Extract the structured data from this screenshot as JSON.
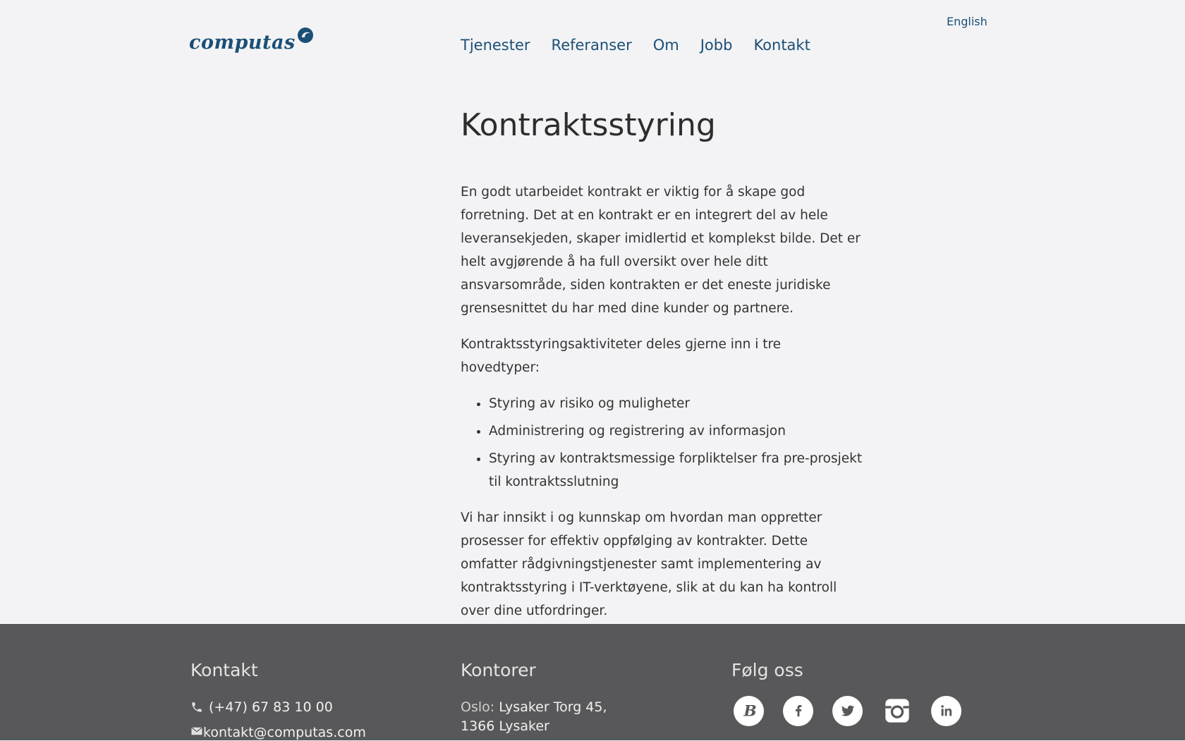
{
  "header": {
    "logo_text": "computas",
    "language_link": "English",
    "nav": [
      "Tjenester",
      "Referanser",
      "Om",
      "Jobb",
      "Kontakt"
    ]
  },
  "article": {
    "title": "Kontraktsstyring",
    "intro": "En godt utarbeidet kontrakt er viktig for å skape god forretning. Det at en kontrakt er en integrert del av hele leveransekjeden, skaper imidlertid et komplekst bilde. Det er helt avgjørende å ha full oversikt over hele ditt ansvarsområde, siden kontrakten er det eneste juridiske grensesnittet du har med dine kunder og partnere.",
    "list_intro": "Kontraktsstyringsaktiviteter deles gjerne inn i tre hovedtyper:",
    "list": [
      "Styring av risiko og muligheter",
      "Administrering og registrering av informasjon",
      "Styring av kontraktsmessige forpliktelser fra  pre-prosjekt til kontraktsslutning"
    ],
    "outro": "Vi har innsikt i og kunnskap om hvordan man oppretter prosesser for effektiv oppfølging av kontrakter. Dette omfatter rådgivningstjenester samt implementering av kontraktsstyring i IT-verktøyene, slik at du kan ha kontroll over dine utfordringer."
  },
  "footer": {
    "contact": {
      "heading": "Kontakt",
      "phone": "(+47) 67 83 10 00",
      "email": "kontakt@computas.com"
    },
    "offices": {
      "heading": "Kontorer",
      "city": "Oslo:",
      "address_line1": "Lysaker Torg 45,",
      "address_line2": "1366 Lysaker"
    },
    "follow": {
      "heading": "Følg oss",
      "icons": [
        "blog-icon",
        "facebook-icon",
        "twitter-icon",
        "instagram-icon",
        "linkedin-icon"
      ]
    }
  },
  "colors": {
    "brand": "#1b4f75",
    "background": "#f3f3f5",
    "footer": "#58585a"
  }
}
